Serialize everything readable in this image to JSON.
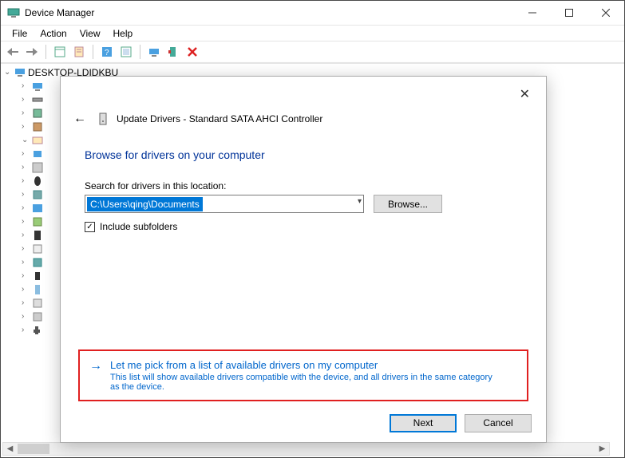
{
  "window": {
    "title": "Device Manager"
  },
  "menubar": [
    "File",
    "Action",
    "View",
    "Help"
  ],
  "tree": {
    "root": "DESKTOP-LDIDKBU",
    "children_count": 19
  },
  "dialog": {
    "title": "Update Drivers - Standard SATA AHCI Controller",
    "heading": "Browse for drivers on your computer",
    "search_label": "Search for drivers in this location:",
    "path": "C:\\Users\\qing\\Documents",
    "browse_label": "Browse...",
    "include_label": "Include subfolders",
    "include_checked": true,
    "pick_title": "Let me pick from a list of available drivers on my computer",
    "pick_desc": "This list will show available drivers compatible with the device, and all drivers in the same category as the device.",
    "next_label": "Next",
    "cancel_label": "Cancel"
  }
}
